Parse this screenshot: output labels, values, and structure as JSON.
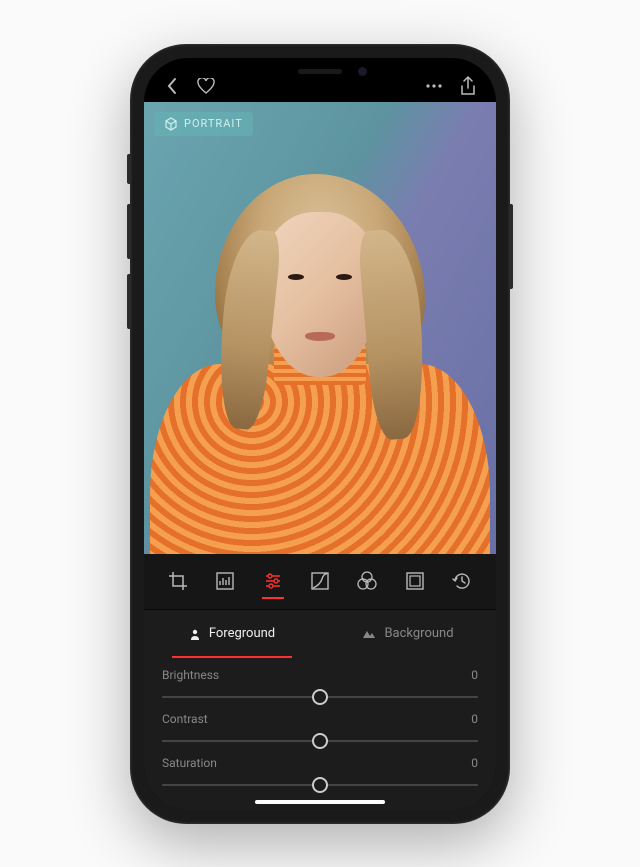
{
  "badge": {
    "label": "PORTRAIT"
  },
  "tools": [
    {
      "name": "crop-icon"
    },
    {
      "name": "histogram-icon"
    },
    {
      "name": "sliders-icon",
      "active": true
    },
    {
      "name": "curves-icon"
    },
    {
      "name": "filters-icon"
    },
    {
      "name": "frame-icon"
    },
    {
      "name": "history-icon"
    }
  ],
  "layer_tabs": {
    "foreground": "Foreground",
    "background": "Background"
  },
  "sliders": {
    "brightness": {
      "label": "Brightness",
      "value": "0"
    },
    "contrast": {
      "label": "Contrast",
      "value": "0"
    },
    "saturation": {
      "label": "Saturation",
      "value": "0"
    }
  },
  "colors": {
    "accent": "#ff3030",
    "panel": "#1c1c1c"
  }
}
